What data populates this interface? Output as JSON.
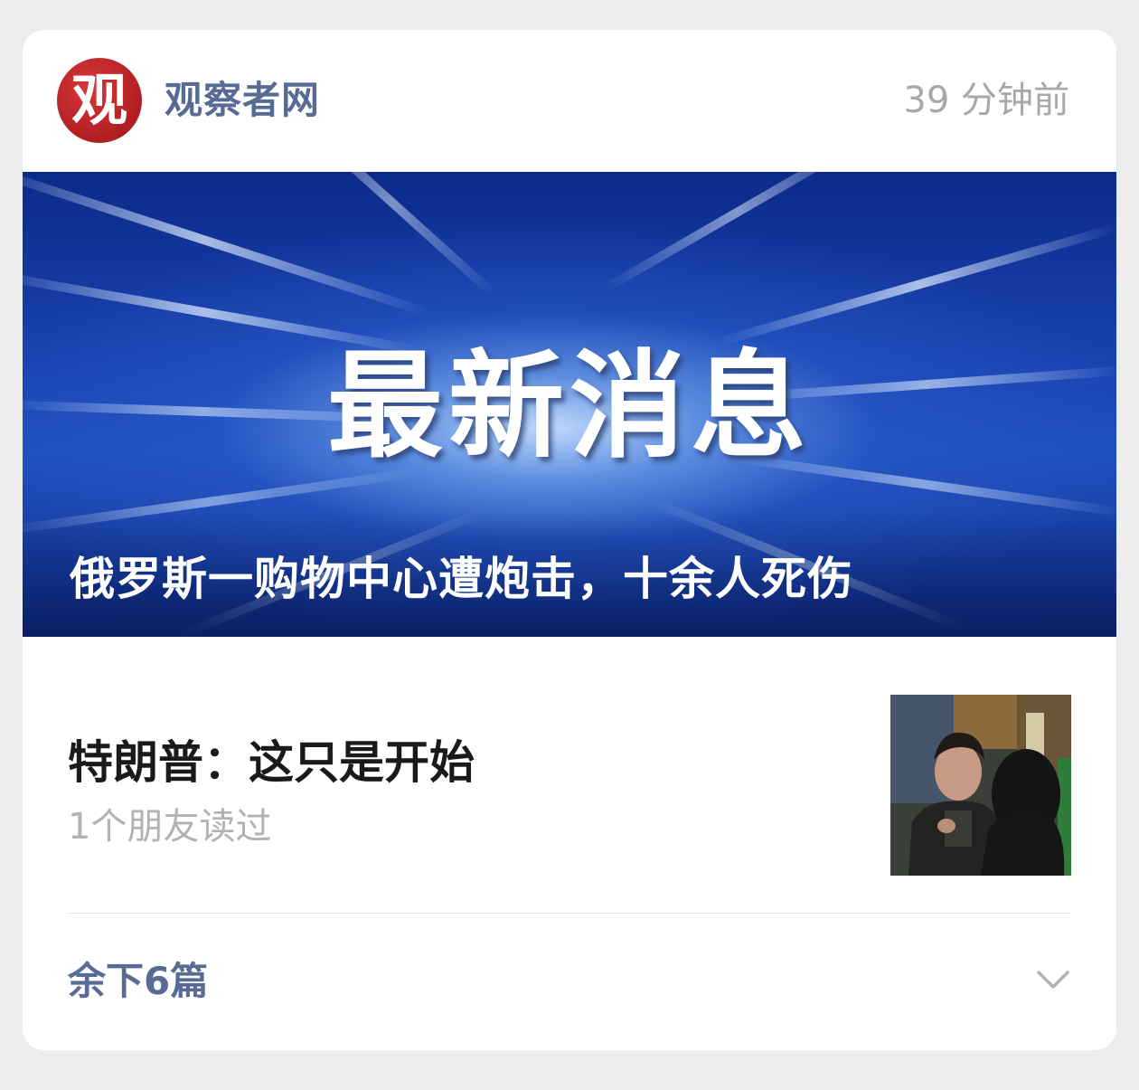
{
  "header": {
    "logo_glyph": "观",
    "account_name": "观察者网",
    "time_ago": "39 分钟前"
  },
  "hero": {
    "big_text": "最新消息",
    "title": "俄罗斯一购物中心遭炮击，十余人死伤"
  },
  "article": {
    "title": "特朗普：这只是开始",
    "meta": "1个朋友读过"
  },
  "footer": {
    "more_label": "余下6篇",
    "expand_icon": "chevron-down-icon"
  },
  "colors": {
    "link_blue": "#576b95",
    "logo_red": "#b01e22",
    "muted_gray": "#a8a8a8"
  }
}
